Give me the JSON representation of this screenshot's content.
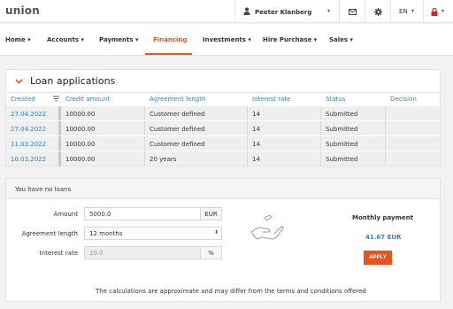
{
  "brand": {
    "logo": "union",
    "accent": "#e8541e",
    "link": "#2a87c8"
  },
  "topbar": {
    "user_name": "Peeter Klanberg",
    "language": "EN",
    "icons": [
      "user-icon",
      "mail-icon",
      "gear-icon",
      "lock-icon"
    ]
  },
  "nav": {
    "items": [
      {
        "label": "Home",
        "active": false
      },
      {
        "label": "Accounts",
        "active": false
      },
      {
        "label": "Payments",
        "active": false
      },
      {
        "label": "Financing",
        "active": true
      },
      {
        "label": "Investments",
        "active": false
      },
      {
        "label": "Hire Purchase",
        "active": false
      },
      {
        "label": "Sales",
        "active": false
      }
    ]
  },
  "loan_applications": {
    "title": "Loan applications",
    "columns": [
      "Created",
      "Credit amount",
      "Agreement length",
      "Interest rate",
      "Status",
      "Decision"
    ],
    "rows": [
      {
        "created": "27.04.2022",
        "credit_amount": "10000.00",
        "agreement_length": "Customer defined",
        "interest_rate": "14",
        "status": "Submitted",
        "decision": ""
      },
      {
        "created": "27.04.2022",
        "credit_amount": "10000.00",
        "agreement_length": "Customer defined",
        "interest_rate": "14",
        "status": "Submitted",
        "decision": ""
      },
      {
        "created": "11.03.2022",
        "credit_amount": "10000.00",
        "agreement_length": "Customer defined",
        "interest_rate": "14",
        "status": "Submitted",
        "decision": ""
      },
      {
        "created": "10.03.2022",
        "credit_amount": "10000.00",
        "agreement_length": "20 years",
        "interest_rate": "14",
        "status": "Submitted",
        "decision": ""
      }
    ]
  },
  "calculator": {
    "title": "You have no loans",
    "amount_label": "Amount",
    "amount_value": "5000.0",
    "amount_currency": "EUR",
    "agreement_length_label": "Agreement length",
    "agreement_length_value": "12 months",
    "interest_rate_label": "Interest rate",
    "interest_rate_value": "10.0",
    "interest_rate_unit": "%",
    "monthly_payment_label": "Monthly payment",
    "monthly_payment_value": "41.67 EUR",
    "apply_label": "APPLY",
    "disclaimer": "The calculations are approximate and may differ from the terms and conditions offered"
  }
}
